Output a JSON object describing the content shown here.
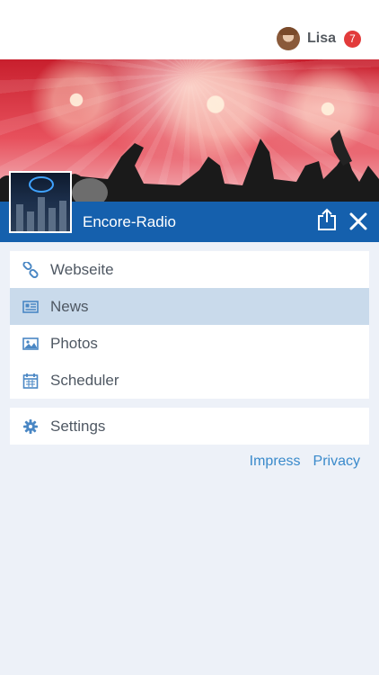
{
  "user": {
    "name": "Lisa",
    "notifications": "7"
  },
  "station": {
    "name": "Encore-Radio"
  },
  "menu": [
    {
      "label": "Webseite",
      "icon": "link-icon"
    },
    {
      "label": "News",
      "icon": "newspaper-icon",
      "active": true
    },
    {
      "label": "Photos",
      "icon": "image-icon"
    },
    {
      "label": "Scheduler",
      "icon": "calendar-icon"
    }
  ],
  "settings": {
    "label": "Settings",
    "icon": "gear-icon"
  },
  "footer": {
    "impress": "Impress",
    "privacy": "Privacy"
  },
  "colors": {
    "accent": "#1560ad",
    "active_row": "#c9daeb",
    "link": "#3a8acb",
    "badge": "#e23b3b",
    "background": "#edf1f8"
  }
}
